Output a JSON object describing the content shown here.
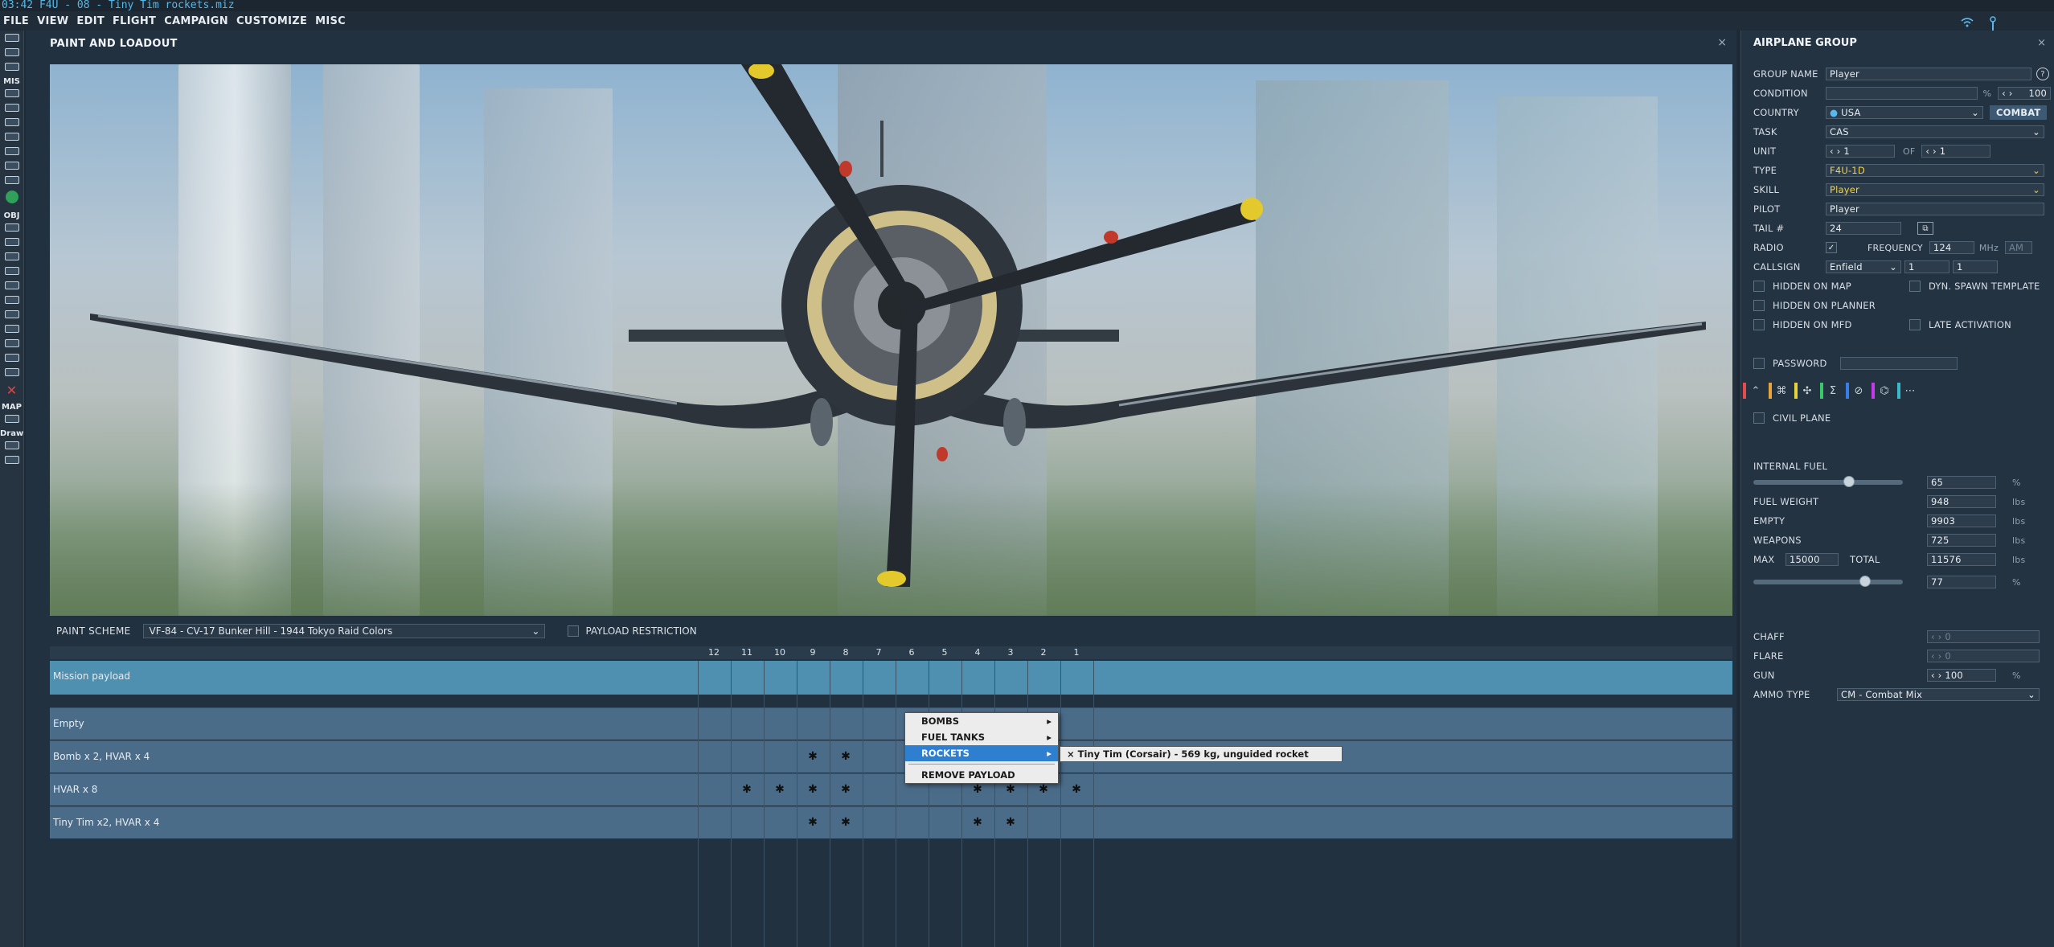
{
  "window": {
    "title": "03:42 F4U - 08 - Tiny Tim rockets.miz"
  },
  "menu": [
    "FILE",
    "VIEW",
    "EDIT",
    "FLIGHT",
    "CAMPAIGN",
    "CUSTOMIZE",
    "MISC"
  ],
  "toolbar": {
    "section_mis": "MIS",
    "section_obj": "OBJ",
    "section_map": "MAP",
    "section_draw": "Draw"
  },
  "paint_panel": {
    "title": "PAINT AND LOADOUT",
    "close": "×",
    "paint_scheme_label": "PAINT SCHEME",
    "paint_scheme_value": "VF-84 - CV-17 Bunker Hill - 1944 Tokyo Raid Colors",
    "payload_restriction_label": "PAYLOAD RESTRICTION",
    "stations": [
      "12",
      "11",
      "10",
      "9",
      "8",
      "7",
      "6",
      "5",
      "4",
      "3",
      "2",
      "1"
    ],
    "rows": [
      {
        "name": "Mission payload",
        "marks": []
      },
      {
        "name": "Empty",
        "marks": []
      },
      {
        "name": "Bomb x 2, HVAR x 4",
        "marks": [
          "9",
          "8",
          "4",
          "3"
        ]
      },
      {
        "name": "HVAR x 8",
        "marks": [
          "11",
          "10",
          "9",
          "8",
          "4",
          "3",
          "2",
          "1"
        ]
      },
      {
        "name": "Tiny Tim x2, HVAR x 4",
        "marks": [
          "9",
          "8",
          "4",
          "3"
        ]
      }
    ]
  },
  "context_menu": {
    "items": [
      "BOMBS",
      "FUEL TANKS",
      "ROCKETS",
      "REMOVE PAYLOAD"
    ],
    "submenu_item": "Tiny Tim (Corsair) - 569 kg, unguided rocket"
  },
  "group_panel": {
    "title": "AIRPLANE GROUP",
    "close": "×",
    "group_name_label": "GROUP NAME",
    "group_name": "Player",
    "help": "?",
    "condition_label": "CONDITION",
    "condition_value": "100",
    "percent": "%",
    "country_label": "COUNTRY",
    "country": "USA",
    "combat": "COMBAT",
    "task_label": "TASK",
    "task": "CAS",
    "unit_label": "UNIT",
    "unit_value": "1",
    "of_label": "OF",
    "unit_total": "1",
    "type_label": "TYPE",
    "type": "F4U-1D",
    "skill_label": "SKILL",
    "skill": "Player",
    "pilot_label": "PILOT",
    "pilot": "Player",
    "tail_label": "TAIL #",
    "tail": "24",
    "radio_label": "RADIO",
    "frequency_label": "FREQUENCY",
    "frequency": "124",
    "mhz": "MHz",
    "am": "AM",
    "callsign_label": "CALLSIGN",
    "callsign": "Enfield",
    "callsign_n1": "1",
    "callsign_n2": "1",
    "hidden_on_map": "HIDDEN ON MAP",
    "dyn_spawn": "DYN. SPAWN TEMPLATE",
    "hidden_on_planner": "HIDDEN ON PLANNER",
    "hidden_on_mfd": "HIDDEN ON MFD",
    "late_activation": "LATE ACTIVATION",
    "password_label": "PASSWORD",
    "civil_plane": "CIVIL PLANE",
    "internal_fuel_label": "INTERNAL FUEL",
    "internal_fuel": "65",
    "internal_fuel_pct": 0.65,
    "fuel_weight_label": "FUEL WEIGHT",
    "fuel_weight": "948",
    "empty_label": "EMPTY",
    "empty": "9903",
    "weapons_label": "WEAPONS",
    "weapons": "725",
    "max_label": "MAX",
    "max": "15000",
    "total_label": "TOTAL",
    "total": "11576",
    "total_pct": "77",
    "total_pct_value": 0.77,
    "lbs": "lbs",
    "chaff_label": "CHAFF",
    "chaff": "0",
    "flare_label": "FLARE",
    "flare": "0",
    "gun_label": "GUN",
    "gun": "100",
    "ammo_label": "AMMO TYPE",
    "ammo": "CM - Combat Mix"
  },
  "colors": {
    "accent": "#54b8e8",
    "mission_row": "#4f8fb0",
    "highlight": "#2f7fd1",
    "yellow": "#f2d34f"
  }
}
